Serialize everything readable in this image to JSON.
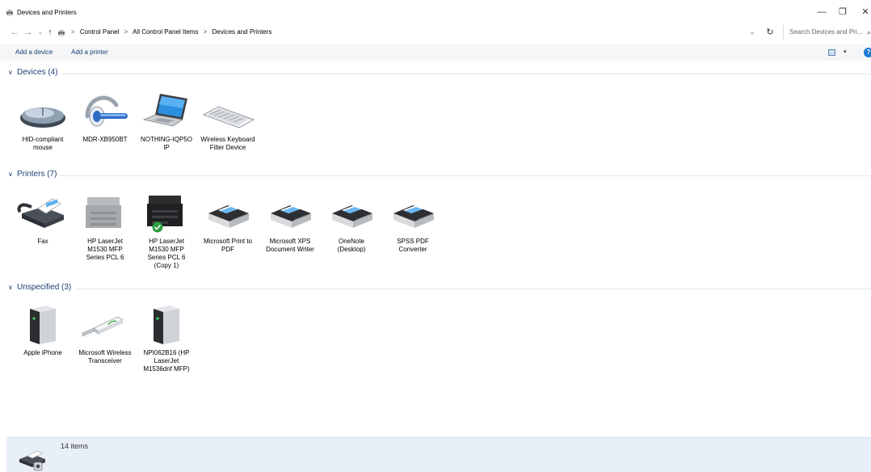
{
  "window": {
    "title": "Devices and Printers",
    "minimize": "—",
    "restore": "❐",
    "close": "✕"
  },
  "nav": {
    "back": "←",
    "forward": "→",
    "recent": "⌄",
    "up": "↑",
    "breadcrumbs": [
      "Control Panel",
      "All Control Panel Items",
      "Devices and Printers"
    ],
    "separator": ">",
    "dropdown": "⌄",
    "refresh": "↻",
    "search_placeholder": "Search Devices and Pri...",
    "search_icon": "⌕"
  },
  "toolbar": {
    "add_device": "Add a device",
    "add_printer": "Add a printer",
    "view_dropdown": "▾",
    "help": "?"
  },
  "groups": {
    "devices": {
      "title": "Devices (4)",
      "items": [
        {
          "label": "HID-compliant mouse",
          "icon": "mouse-icon"
        },
        {
          "label": "MDR-XB950BT",
          "icon": "headset-icon"
        },
        {
          "label": "NOTHING-IQP5O IP",
          "icon": "laptop-icon"
        },
        {
          "label": "Wireless Keyboard Filter Device",
          "icon": "keyboard-icon"
        }
      ]
    },
    "printers": {
      "title": "Printers (7)",
      "items": [
        {
          "label": "Fax",
          "icon": "fax-icon"
        },
        {
          "label": "HP LaserJet M1530 MFP Series PCL 6",
          "icon": "mfp-printer-icon"
        },
        {
          "label": "HP LaserJet M1530 MFP Series PCL 6 (Copy 1)",
          "icon": "mfp-printer-default-icon"
        },
        {
          "label": "Microsoft Print to PDF",
          "icon": "printer-icon"
        },
        {
          "label": "Microsoft XPS Document Writer",
          "icon": "printer-icon"
        },
        {
          "label": "OneNote (Desktop)",
          "icon": "printer-icon"
        },
        {
          "label": "SPSS PDF Converter",
          "icon": "printer-icon"
        }
      ]
    },
    "unspecified": {
      "title": "Unspecified (3)",
      "items": [
        {
          "label": "Apple iPhone",
          "icon": "tower-icon"
        },
        {
          "label": "Microsoft Wireless Transceiver",
          "icon": "usb-dongle-icon"
        },
        {
          "label": "NPI062B16 (HP LaserJet M1536dnf MFP)",
          "icon": "tower-icon"
        }
      ]
    }
  },
  "status": {
    "count": "14 items"
  },
  "colors": {
    "link": "#1a3e72",
    "statusbar": "#e8eff9",
    "default_check": "#2e9e3e"
  }
}
